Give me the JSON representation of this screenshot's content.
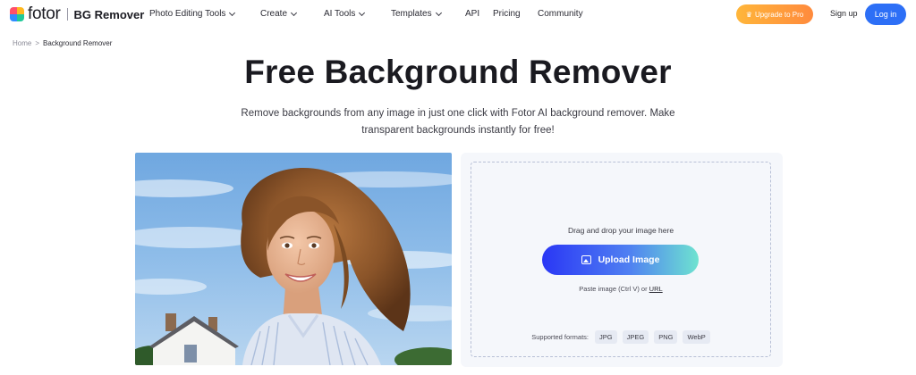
{
  "nav": {
    "logo_text": "fotor",
    "product": "BG Remover",
    "menu": [
      {
        "label": "Photo Editing Tools",
        "dropdown": true
      },
      {
        "label": "Create",
        "dropdown": true
      },
      {
        "label": "AI Tools",
        "dropdown": true
      },
      {
        "label": "Templates",
        "dropdown": true
      },
      {
        "label": "API",
        "dropdown": false
      },
      {
        "label": "Pricing",
        "dropdown": false
      },
      {
        "label": "Community",
        "dropdown": false
      }
    ],
    "upgrade_label": "Upgrade to Pro",
    "signup_label": "Sign up",
    "login_label": "Log in"
  },
  "breadcrumb": {
    "home": "Home",
    "separator": ">",
    "current": "Background Remover"
  },
  "hero": {
    "title": "Free Background Remover",
    "subtitle": "Remove backgrounds from any image in just one click with Fotor AI background remover. Make transparent backgrounds instantly for free!"
  },
  "upload": {
    "drag_text": "Drag and drop your image here",
    "button_label": "Upload Image",
    "paste_text": "Paste image (Ctrl V) or",
    "url_label": "URL",
    "formats_label": "Supported formats:",
    "formats": [
      "JPG",
      "JPEG",
      "PNG",
      "WebP"
    ]
  },
  "colors": {
    "login_bg": "#2d6ff6",
    "upgrade_from": "#ffb63a",
    "upgrade_to": "#ff8a3d",
    "upload_from": "#2a37f5",
    "upload_to": "#6ee3d0"
  },
  "icons": [
    "logo-icon",
    "chevron-down-icon",
    "crown-icon",
    "image-icon"
  ]
}
